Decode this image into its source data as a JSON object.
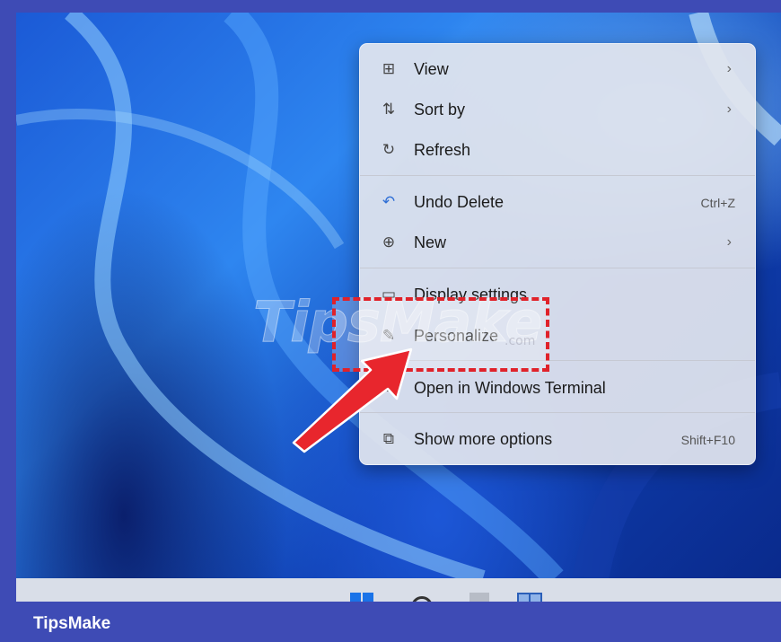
{
  "context_menu": {
    "items": [
      {
        "icon": "view-grid-icon",
        "glyph": "⊞",
        "label": "View",
        "submenu": true
      },
      {
        "icon": "sort-icon",
        "glyph": "⇅",
        "label": "Sort by",
        "submenu": true
      },
      {
        "icon": "refresh-icon",
        "glyph": "↻",
        "label": "Refresh"
      },
      {
        "icon": "undo-icon",
        "glyph": "↶",
        "label": "Undo Delete",
        "shortcut": "Ctrl+Z"
      },
      {
        "icon": "new-plus-icon",
        "glyph": "⊕",
        "label": "New",
        "submenu": true
      },
      {
        "icon": "display-settings-icon",
        "glyph": "▭",
        "label": "Display settings"
      },
      {
        "icon": "personalize-brush-icon",
        "glyph": "✎",
        "label": "Personalize"
      },
      {
        "icon": "terminal-icon",
        "glyph": "›",
        "label": "Open in Windows Terminal"
      },
      {
        "icon": "show-more-options-icon",
        "glyph": "⧉",
        "label": "Show more options",
        "shortcut": "Shift+F10"
      }
    ],
    "submenu_glyph": "›"
  },
  "watermark": {
    "text": "TipsMake",
    "suffix": ".com"
  },
  "footer": {
    "brand": "TipsMake"
  },
  "colors": {
    "highlight": "#e0222a",
    "footer": "#3e4bb5",
    "accent": "#1a73e8"
  }
}
